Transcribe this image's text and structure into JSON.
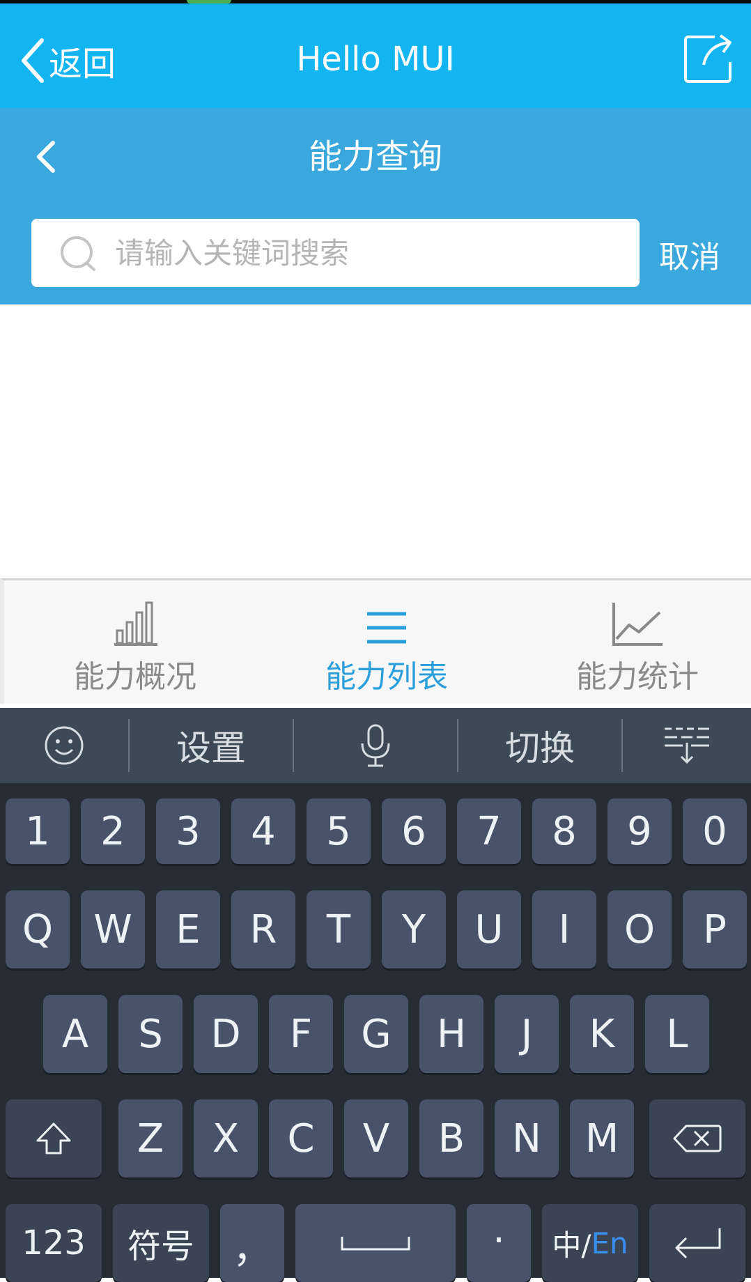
{
  "header": {
    "back_label": "返回",
    "title": "Hello MUI"
  },
  "subheader": {
    "title": "能力查询"
  },
  "search": {
    "placeholder": "请输入关键词搜索",
    "cancel_label": "取消"
  },
  "tabs": [
    {
      "label": "能力概况",
      "icon": "bar-chart-icon",
      "active": false
    },
    {
      "label": "能力列表",
      "icon": "list-icon",
      "active": true
    },
    {
      "label": "能力统计",
      "icon": "line-chart-icon",
      "active": false
    }
  ],
  "keyboard": {
    "toolbar": {
      "settings": "设置",
      "switch": "切换"
    },
    "row_numbers": [
      "1",
      "2",
      "3",
      "4",
      "5",
      "6",
      "7",
      "8",
      "9",
      "0"
    ],
    "row1": [
      "Q",
      "W",
      "E",
      "R",
      "T",
      "Y",
      "U",
      "I",
      "O",
      "P"
    ],
    "row2": [
      "A",
      "S",
      "D",
      "F",
      "G",
      "H",
      "J",
      "K",
      "L"
    ],
    "row3": [
      "Z",
      "X",
      "C",
      "V",
      "B",
      "N",
      "M"
    ],
    "bottom": {
      "num": "123",
      "symbols": "符号",
      "comma": "，",
      "period": "·",
      "lang_zh": "中/",
      "lang_en": "En"
    }
  },
  "colors": {
    "nav_primary": "#12b4f2",
    "nav_secondary": "#3aa8dd",
    "tab_active": "#2a9fdb",
    "tab_inactive": "#8a8a8a",
    "keyboard_bg": "#252c36",
    "keyboard_key": "#48536a",
    "lang_en_accent": "#3a8ef0"
  }
}
